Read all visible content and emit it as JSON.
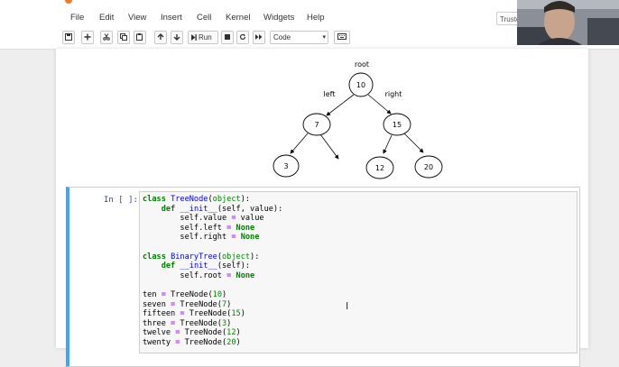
{
  "menu": {
    "items": [
      "File",
      "Edit",
      "View",
      "Insert",
      "Cell",
      "Kernel",
      "Widgets",
      "Help"
    ],
    "trusted": "Truste"
  },
  "toolbar": {
    "run_label": "Run",
    "cell_type": "Code"
  },
  "tree": {
    "root_label": "root",
    "left_label": "left",
    "right_label": "right",
    "nodes": [
      "10",
      "7",
      "15",
      "3",
      "12",
      "20"
    ]
  },
  "cell": {
    "prompt": "In [ ]:"
  },
  "code_lines": [
    "class TreeNode(object):",
    "    def __init__(self, value):",
    "        self.value = value",
    "        self.left = None",
    "        self.right = None",
    "",
    "class BinaryTree(object):",
    "    def __init__(self):",
    "        self.root = None",
    "",
    "ten = TreeNode(10)",
    "seven = TreeNode(7)",
    "fifteen = TreeNode(15)",
    "three = TreeNode(3)",
    "twelve = TreeNode(12)",
    "twenty = TreeNode(20)"
  ],
  "colors": {
    "cell_border_active": "#42a5f5",
    "keyword": "#008000",
    "class_name": "#0000ff",
    "number": "#008800",
    "operator": "#aa22ff",
    "prompt": "#303f9f"
  }
}
